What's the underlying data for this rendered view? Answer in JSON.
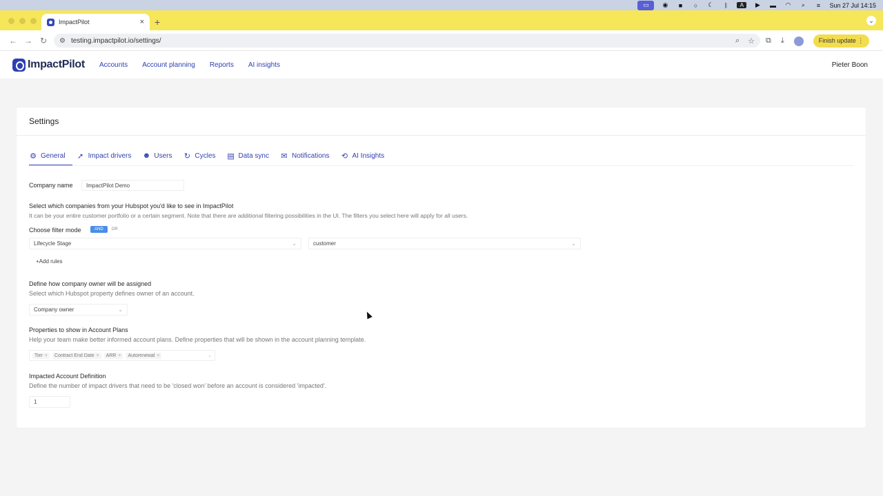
{
  "os_menubar": {
    "clock": "Sun 27 Jul  14:15"
  },
  "browser": {
    "tab_title": "ImpactPilot",
    "tab_close": "×",
    "new_tab": "+",
    "url": "testing.impactpilot.io/settings/",
    "finish_update": "Finish update"
  },
  "app": {
    "logo_text": "ImpactPilot",
    "nav": [
      "Accounts",
      "Account planning",
      "Reports",
      "AI insights"
    ],
    "user_name": "Pieter Boon"
  },
  "settings": {
    "title": "Settings",
    "tabs": [
      {
        "label": "General",
        "icon": "gear-icon"
      },
      {
        "label": "Impact drivers",
        "icon": "rocket-icon"
      },
      {
        "label": "Users",
        "icon": "users-icon"
      },
      {
        "label": "Cycles",
        "icon": "cycle-icon"
      },
      {
        "label": "Data sync",
        "icon": "database-icon"
      },
      {
        "label": "Notifications",
        "icon": "mail-icon"
      },
      {
        "label": "AI Insights",
        "icon": "refresh-icon"
      }
    ],
    "company_name_label": "Company name",
    "company_name_value": "ImpactPilot Demo",
    "companies_heading": "Select which companies from your Hubspot you'd like to see in ImpactPilot",
    "companies_hint": "It can be your entire customer portfolio or a certain segment. Note that there are additional filtering possibilities in the UI. The filters you select here will apply for all users.",
    "filter_mode_label": "Choose filter mode",
    "filter_mode_and": "AND",
    "filter_mode_or": "OR",
    "filter_property": "Lifecycle Stage",
    "filter_value": "customer",
    "add_rules": "+Add rules",
    "owner_heading": "Define how company owner will be assigned",
    "owner_hint": "Select which Hubspot property defines owner of an account.",
    "owner_value": "Company owner",
    "props_heading": "Properties to show in Account Plans",
    "props_hint": "Help your team make better informed account plans. Define properties that will be shown in the account planning template.",
    "props_chips": [
      "Tier",
      "Contract End Date",
      "ARR",
      "Autorenewal"
    ],
    "impacted_heading": "Impacted Account Definition",
    "impacted_hint": "Define the number of impact drivers that need to be 'closed won' before an account is considered 'impacted'.",
    "impacted_value": "1"
  }
}
